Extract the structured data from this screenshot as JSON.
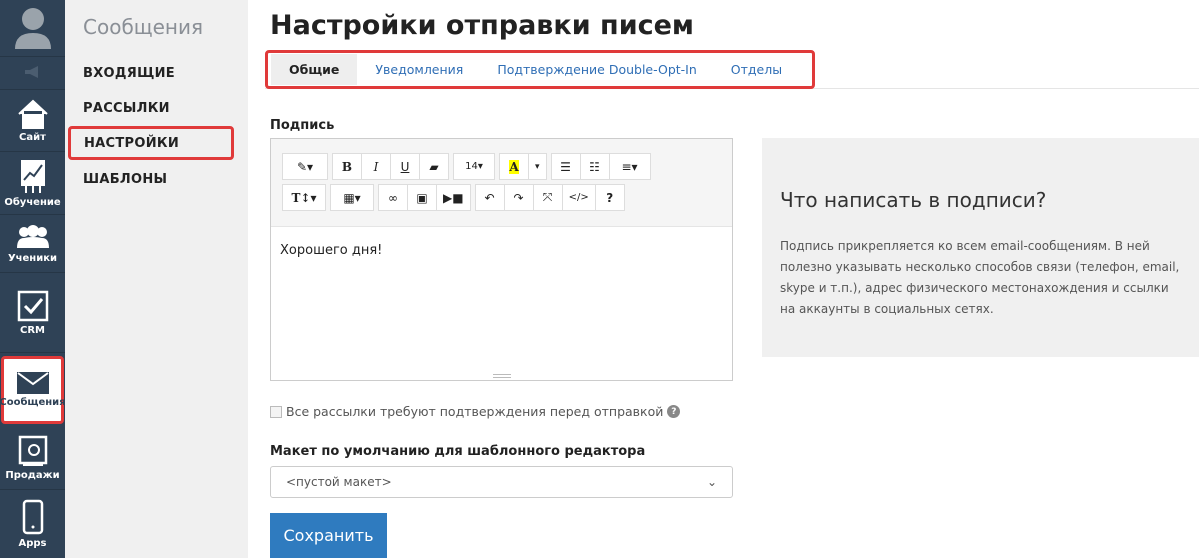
{
  "rail": [
    {
      "label": ""
    },
    {
      "label": ""
    },
    {
      "label": "Сайт"
    },
    {
      "label": "Обучение"
    },
    {
      "label": "Ученики"
    },
    {
      "label": "CRM"
    },
    {
      "label": "Сообщения"
    },
    {
      "label": "Продажи"
    },
    {
      "label": "Apps"
    }
  ],
  "sub": {
    "title": "Сообщения",
    "items": [
      "ВХОДЯЩИЕ",
      "РАССЫЛКИ",
      "НАСТРОЙКИ",
      "ШАБЛОНЫ"
    ]
  },
  "page": {
    "title": "Настройки отправки писем"
  },
  "tabs": [
    "Общие",
    "Уведомления",
    "Подтверждение Double-Opt-In",
    "Отделы"
  ],
  "signature": {
    "label": "Подпись",
    "font_size": "14",
    "content": "Хорошего дня!"
  },
  "info": {
    "title": "Что написать в подписи?",
    "text": "Подпись прикрепляется ко всем email-сообщениям. В ней полезно указывать несколько способов связи (телефон, email, skype и т.п.), адрес физического местонахождения и ссылки на аккаунты в социальных сетях."
  },
  "confirm": {
    "label": "Все рассылки требуют подтверждения перед отправкой",
    "checked": false
  },
  "layout": {
    "label": "Макет по умолчанию для шаблонного редактора",
    "value": "<пустой макет>"
  },
  "save": "Сохранить",
  "colors": {
    "rail": "#2f4256",
    "accent": "#2f7bbf",
    "highlight": "#e03a3a"
  }
}
